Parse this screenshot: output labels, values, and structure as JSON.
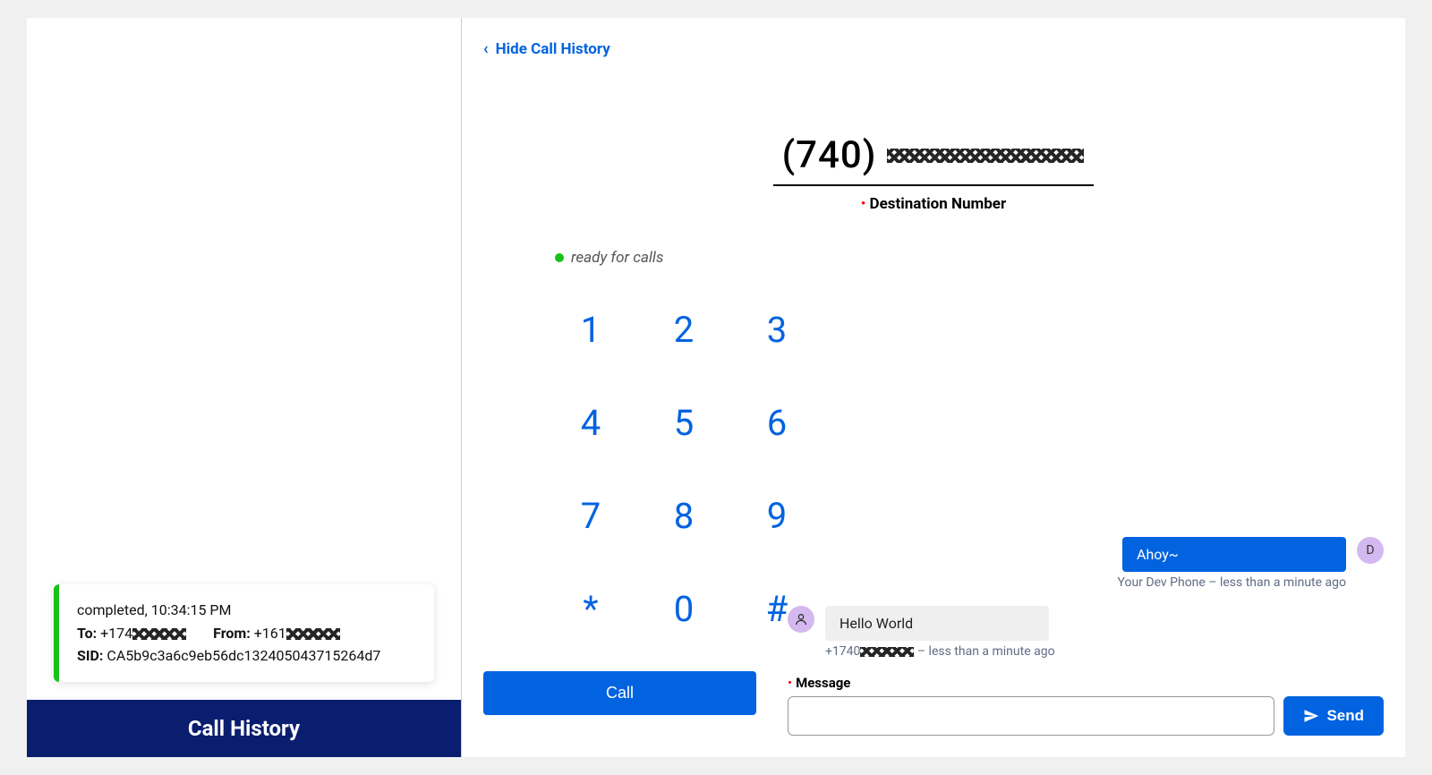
{
  "header": {
    "hide_label": "Hide Call History"
  },
  "sidebar": {
    "footer_title": "Call History",
    "entry": {
      "status_time": "completed, 10:34:15 PM",
      "to_label": "To:",
      "to_value": "+174",
      "from_label": "From:",
      "from_value": "+161",
      "sid_label": "SID:",
      "sid_value": "CA5b9c3a6c9eb56dc132405043715264d7"
    }
  },
  "dialer": {
    "destination_value_prefix": "(740)",
    "destination_label": "Destination Number",
    "status_text": "ready for calls",
    "keys": [
      "1",
      "2",
      "3",
      "4",
      "5",
      "6",
      "7",
      "8",
      "9",
      "*",
      "0",
      "#"
    ],
    "call_label": "Call"
  },
  "messages": {
    "sent": {
      "text": "Ahoy~",
      "avatar_initial": "D",
      "meta": "Your Dev Phone – less than a minute ago"
    },
    "recv": {
      "text": "Hello World",
      "meta_prefix": "+1740",
      "meta_suffix": " – less than a minute ago"
    },
    "input_label": "Message",
    "send_label": "Send"
  }
}
